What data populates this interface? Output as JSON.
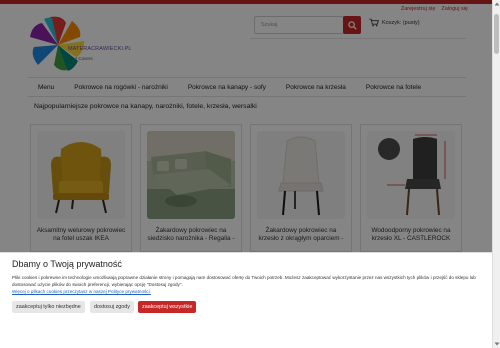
{
  "header": {
    "top_links": {
      "register": "Zarejestruj się",
      "login": "Zaloguj się"
    },
    "logo_text": "MATERACRAWIECKI.PL",
    "logo_sub": "Your Covers",
    "search_placeholder": "Szukaj",
    "cart_label": "Koszyk: (pusty)"
  },
  "nav": {
    "items": [
      {
        "label": "Menu"
      },
      {
        "label": "Pokrowce na rogówki - narożniki"
      },
      {
        "label": "Pokrowce na kanapy - sofy"
      },
      {
        "label": "Pokrowce na krzesła"
      },
      {
        "label": "Pokrowce na fotele"
      }
    ]
  },
  "main": {
    "section_title": "Najpopularniejsze pokrowce na kanapy, narożniki, fotele, krzesła, wersalki",
    "products": [
      {
        "title": "Aksamitny welurowy pokrowiec na fotel uszak IKEA"
      },
      {
        "title": "Żakardowy pokrowiec na siedzisko narożnika - Regalia -"
      },
      {
        "title": "Żakardowy pokrowiec na krzesło z okrągłym oparciem -"
      },
      {
        "title": "Wodoodporny pokrowiec na krzesło XL - CASTLEROCK"
      }
    ]
  },
  "cookie": {
    "title": "Dbamy o Twoją prywatność",
    "text": "Pliki cookies i pokrewne im technologie umożliwiają poprawne działanie strony i pomagają nam dostosować ofertę do Twoich potrzeb. Możesz zaakceptować wykorzystanie przez nas wszystkich tych plików i przejść do sklepu lub dostosować użycie plików do swoich preferencji, wybierając opcję \"Dostosuj zgody\".",
    "link_text": "Więcej o plikach cookies przeczytasz w naszej Polityce prywatności.",
    "buttons": {
      "necessary": "zaakceptuj tylko niezbędne",
      "customize": "dostosuj zgody",
      "accept_all": "zaakceptuj wszystkie"
    }
  },
  "colors": {
    "accent": "#c62828",
    "link": "#1f5fbf"
  },
  "icons": {
    "search": "search-icon",
    "cart": "cart-icon"
  }
}
